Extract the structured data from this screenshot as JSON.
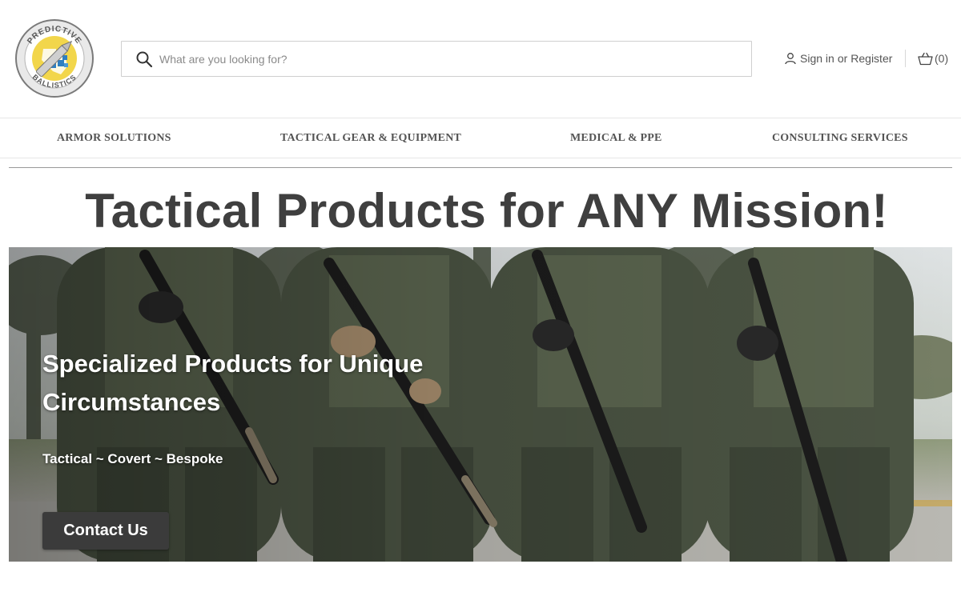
{
  "header": {
    "logo": {
      "icon": "predictive-ballistics-logo",
      "text_top": "PREDICTIVE",
      "text_bottom": "BALLISTICS"
    },
    "search": {
      "placeholder": "What are you looking for?",
      "icon": "search-icon"
    },
    "account": {
      "icon": "user-icon",
      "sign_in": "Sign in",
      "or": "or",
      "register": "Register"
    },
    "cart": {
      "icon": "cart-icon",
      "count": "(0)"
    }
  },
  "nav": {
    "items": [
      {
        "label": "ARMOR SOLUTIONS"
      },
      {
        "label": "TACTICAL GEAR & EQUIPMENT"
      },
      {
        "label": "MEDICAL & PPE"
      },
      {
        "label": "CONSULTING SERVICES"
      }
    ]
  },
  "main": {
    "title": "Tactical Products for ANY Mission!"
  },
  "hero": {
    "heading": "Specialized Products for Unique Circumstances",
    "subheading": "Tactical ~ Covert ~ Bespoke",
    "button_label": "Contact Us"
  },
  "colors": {
    "text_dark": "#3f3f3f",
    "nav_text": "#545454",
    "button_bg": "#3b3b3b",
    "logo_yellow": "#f2d64b",
    "logo_blue": "#2f7fc1"
  }
}
